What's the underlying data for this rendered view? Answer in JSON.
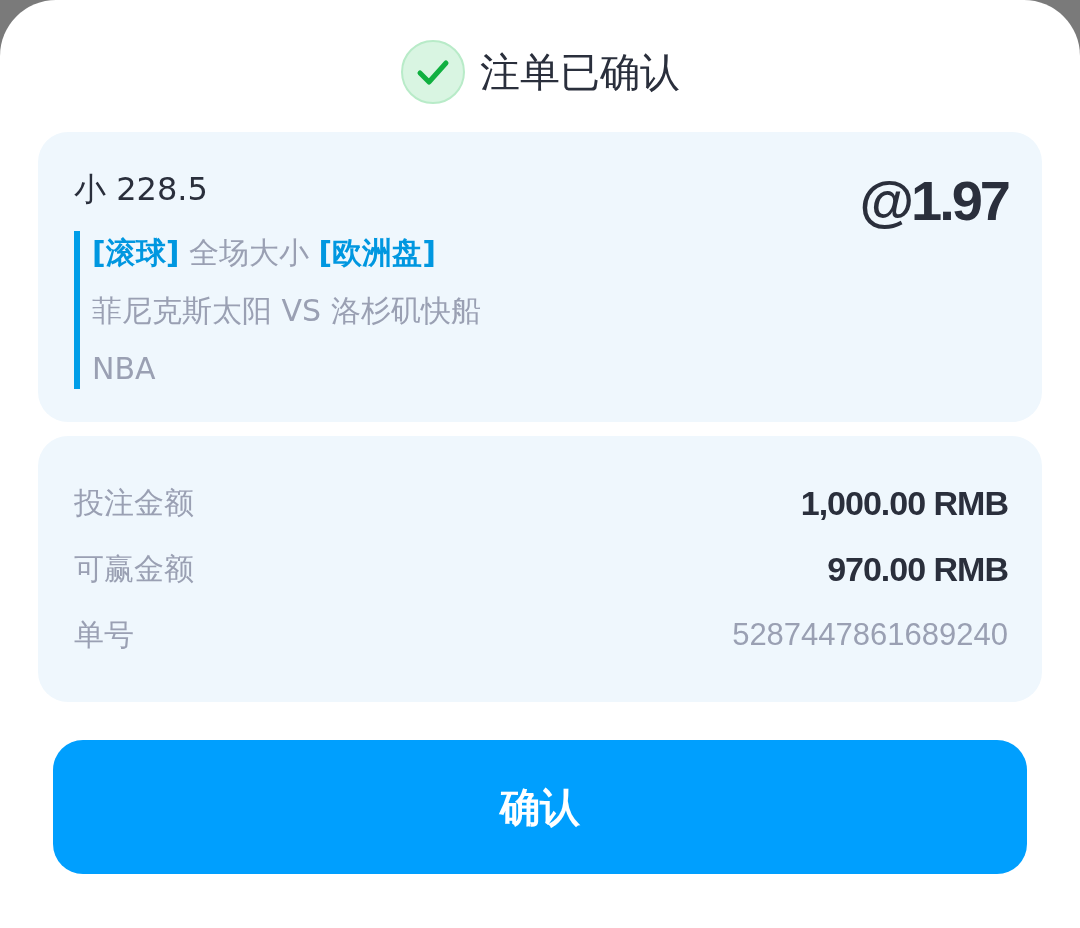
{
  "header": {
    "title": "注单已确认"
  },
  "bet": {
    "selection": "小 228.5",
    "odds": "@1.97",
    "market": [
      {
        "kind": "tag",
        "text": "[滚球]"
      },
      {
        "kind": "text",
        "text": " 全场大小 "
      },
      {
        "kind": "tag",
        "text": "[欧洲盘]"
      }
    ],
    "match": "菲尼克斯太阳 VS 洛杉矶快船",
    "league": "NBA"
  },
  "details": [
    {
      "label": "投注金额",
      "value": "1,000.00 RMB",
      "kind": "amount"
    },
    {
      "label": "可赢金额",
      "value": "970.00 RMB",
      "kind": "amount"
    },
    {
      "label": "单号",
      "value": "5287447861689240",
      "kind": "id"
    }
  ],
  "button": "确认"
}
